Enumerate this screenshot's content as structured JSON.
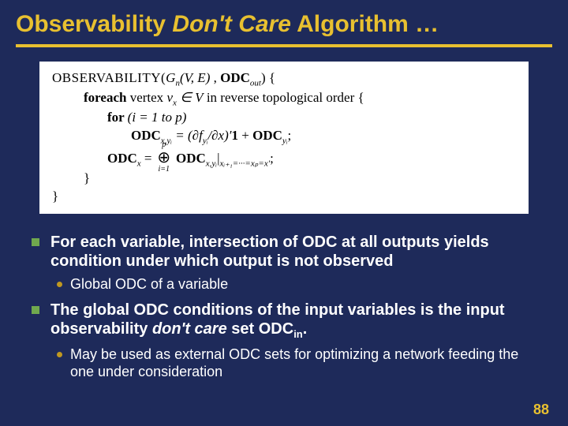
{
  "title": {
    "t1": "Observability ",
    "t2": "Don't Care",
    "t3": " Algorithm …"
  },
  "algo": {
    "l1a": "OBSERVABILITY(",
    "l1b": "G",
    "l1b_sub": "n",
    "l1c": "(V, E)",
    "l1d": " , ",
    "l1e": "ODC",
    "l1e_sub": "out",
    "l1f": ") {",
    "l2a": "foreach ",
    "l2b": "vertex ",
    "l2c": "v",
    "l2c_sub": "x",
    "l2d": " ∈ V",
    "l2e": " in reverse topological order {",
    "l3a": "for ",
    "l3b": "(i = 1 to p)",
    "l4a": "ODC",
    "l4a_sub": "x,yᵢ",
    "l4b": " = (∂f",
    "l4b_sub": "yᵢ",
    "l4c": "/∂x)′",
    "l4d": "1",
    "l4e": " + ",
    "l4f": "ODC",
    "l4f_sub": "yᵢ",
    "l4g": ";",
    "l5a": "ODC",
    "l5a_sub": "x",
    "l5b": " = ",
    "l5c": "⊕",
    "l5c_top": "p",
    "l5c_bot": "i=1",
    "l5d": " ODC",
    "l5d_sub": "x,yᵢ",
    "l5e": "|",
    "l5e_sub": "xᵢ₊₁=···=xₚ=x′",
    "l5f": ";",
    "l6": "}",
    "l7": "}"
  },
  "bullets": {
    "b1": "For each variable, intersection of ODC at all outputs yields condition under which output is not observed",
    "b1s1": "Global ODC of a variable",
    "b2a": "The global ODC conditions of the input variables is the input observability ",
    "b2b": "don't care",
    "b2c": " set ODC",
    "b2d": "in",
    "b2e": ".",
    "b2s1": "May be used as external ODC sets for optimizing a network feeding the one under consideration"
  },
  "page": "88"
}
